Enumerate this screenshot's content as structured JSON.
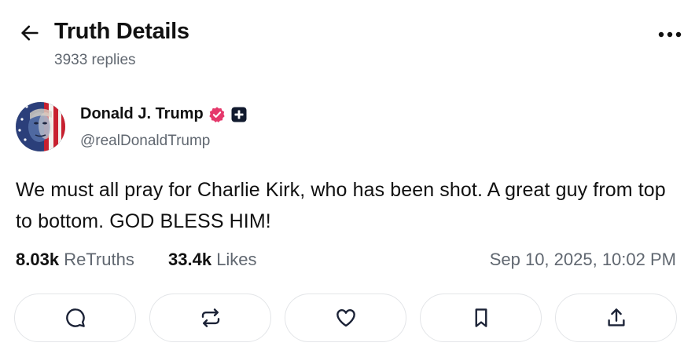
{
  "header": {
    "title": "Truth Details",
    "subtitle": "3933 replies"
  },
  "post": {
    "author": {
      "name": "Donald J. Trump",
      "handle": "@realDonaldTrump",
      "verified_badge_icon": "verified-badge-icon",
      "plus_badge_icon": "plus-badge-icon"
    },
    "text": "We must all pray for Charlie Kirk, who has been shot. A great guy from top to bottom. GOD BLESS HIM!",
    "stats": {
      "retruths_count": "8.03k",
      "retruths_label": "ReTruths",
      "likes_count": "33.4k",
      "likes_label": "Likes",
      "timestamp": "Sep 10, 2025, 10:02 PM"
    },
    "actions": [
      {
        "name": "reply",
        "icon": "comment-icon"
      },
      {
        "name": "retruth",
        "icon": "repost-icon"
      },
      {
        "name": "like",
        "icon": "heart-icon"
      },
      {
        "name": "bookmark",
        "icon": "bookmark-icon"
      },
      {
        "name": "share",
        "icon": "share-icon"
      }
    ]
  },
  "colors": {
    "text_primary": "#111111",
    "text_secondary": "#606770",
    "verified_badge": "#e5386b",
    "button_border": "#e3e5e8",
    "icon": "#1b2236"
  }
}
